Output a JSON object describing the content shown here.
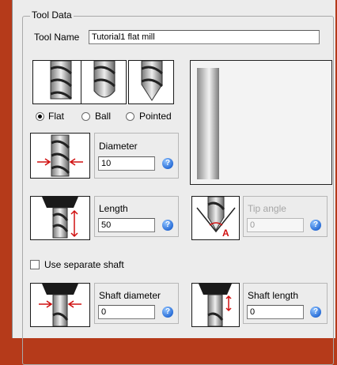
{
  "group": {
    "title": "Tool Data"
  },
  "tool_name": {
    "label": "Tool Name",
    "value": "Tutorial1 flat mill"
  },
  "tool_types": {
    "options": [
      {
        "label": "Flat",
        "selected": true
      },
      {
        "label": "Ball",
        "selected": false
      },
      {
        "label": "Pointed",
        "selected": false
      }
    ]
  },
  "diameter": {
    "label": "Diameter",
    "value": "10",
    "icon": "diameter-icon"
  },
  "length": {
    "label": "Length",
    "value": "50",
    "icon": "length-icon"
  },
  "tip_angle": {
    "label": "Tip angle",
    "value": "0",
    "enabled": false,
    "icon": "tip-angle-icon"
  },
  "separate_shaft": {
    "label": "Use separate shaft",
    "checked": false
  },
  "shaft_diameter": {
    "label": "Shaft diameter",
    "value": "0",
    "icon": "shaft-diameter-icon"
  },
  "shaft_length": {
    "label": "Shaft length",
    "value": "0",
    "icon": "shaft-length-icon"
  },
  "help_glyph": "?",
  "colors": {
    "frame": "#b53a1a",
    "panel": "#ececec",
    "help": "#2b6fd8",
    "arrow": "#d01010"
  }
}
